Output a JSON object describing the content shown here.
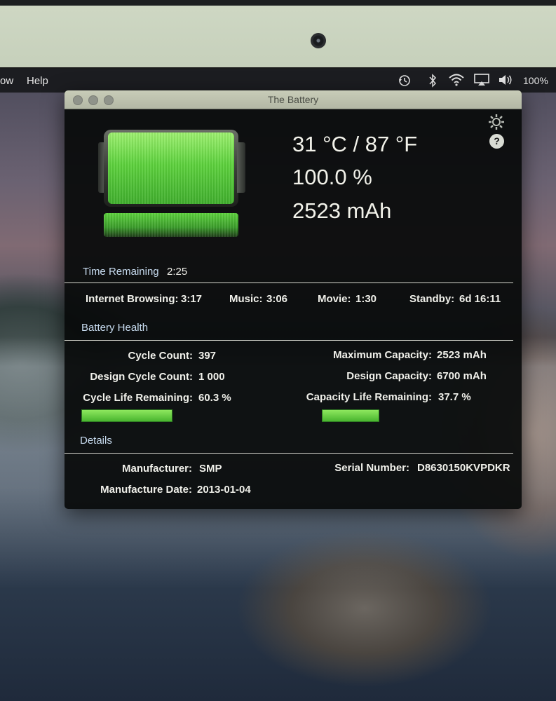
{
  "menubar": {
    "left_items": [
      "ow",
      "Help"
    ],
    "tray_icons": [
      "time-machine-icon",
      "bluetooth-icon",
      "wifi-icon",
      "airplay-icon",
      "volume-icon"
    ],
    "battery_percent": "100%"
  },
  "window": {
    "title": "The Battery",
    "temperature": "31 °C / 87 °F",
    "charge_percent": "100.0 %",
    "capacity_mah": "2523 mAh",
    "charge_level": 1.0,
    "time_remaining": {
      "label": "Time Remaining",
      "value": "2:25"
    },
    "estimates": [
      {
        "label": "Internet Browsing:",
        "value": "3:17"
      },
      {
        "label": "Music:",
        "value": "3:06"
      },
      {
        "label": "Movie:",
        "value": "1:30"
      },
      {
        "label": "Standby:",
        "value": "6d 16:11"
      }
    ],
    "health": {
      "heading": "Battery Health",
      "cycle_count": {
        "label": "Cycle Count:",
        "value": "397"
      },
      "design_cycle_count": {
        "label": "Design Cycle Count:",
        "value": "1 000"
      },
      "cycle_life_remaining": {
        "label": "Cycle Life Remaining:",
        "value": "60.3 %",
        "fraction": 0.603
      },
      "max_capacity": {
        "label": "Maximum Capacity:",
        "value": "2523 mAh"
      },
      "design_capacity": {
        "label": "Design Capacity:",
        "value": "6700 mAh"
      },
      "capacity_life_remaining": {
        "label": "Capacity Life Remaining:",
        "value": "37.7 %",
        "fraction": 0.377
      }
    },
    "details": {
      "heading": "Details",
      "manufacturer": {
        "label": "Manufacturer:",
        "value": "SMP"
      },
      "manufacture_date": {
        "label": "Manufacture Date:",
        "value": "2013-01-04"
      },
      "serial_number": {
        "label": "Serial Number:",
        "value": "D8630150KVPDKR"
      }
    }
  },
  "colors": {
    "battery_green": "#5cd13c",
    "window_bg": "#080a0a",
    "section_label": "#c8dcf0"
  }
}
